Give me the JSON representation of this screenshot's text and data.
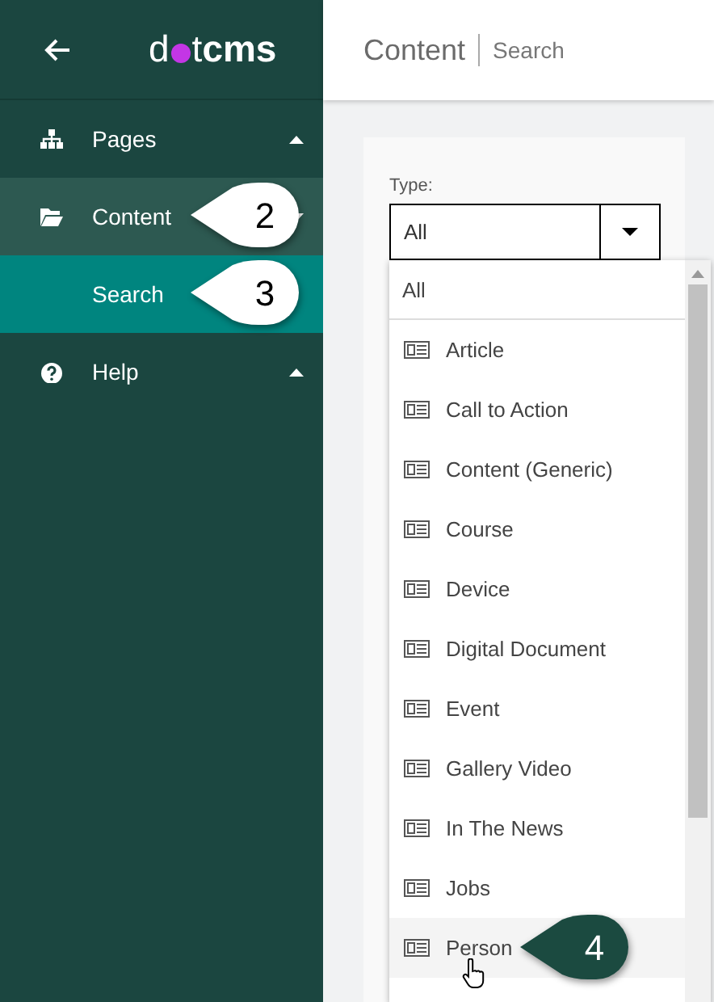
{
  "logo": {
    "before_dot": "d",
    "after_dot": "t",
    "bold": "cms"
  },
  "sidebar": {
    "items": [
      {
        "label": "Pages",
        "selected": false,
        "expanded": false
      },
      {
        "label": "Content",
        "selected": false,
        "expanded": true,
        "children": [
          {
            "label": "Search",
            "selected": true
          }
        ]
      },
      {
        "label": "Help",
        "selected": false,
        "expanded": false
      }
    ]
  },
  "header": {
    "title": "Content",
    "subtitle": "Search"
  },
  "type_field": {
    "label": "Type:",
    "value": "All"
  },
  "dropdown": {
    "items": [
      {
        "label": "All",
        "kind": "plain",
        "hovered": false
      },
      {
        "label": "Article",
        "kind": "type",
        "hovered": false
      },
      {
        "label": "Call to Action",
        "kind": "type",
        "hovered": false
      },
      {
        "label": "Content (Generic)",
        "kind": "type",
        "hovered": false
      },
      {
        "label": "Course",
        "kind": "type",
        "hovered": false
      },
      {
        "label": "Device",
        "kind": "type",
        "hovered": false
      },
      {
        "label": "Digital Document",
        "kind": "type",
        "hovered": false
      },
      {
        "label": "Event",
        "kind": "type",
        "hovered": false
      },
      {
        "label": "Gallery Video",
        "kind": "type",
        "hovered": false
      },
      {
        "label": "In The News",
        "kind": "type",
        "hovered": false
      },
      {
        "label": "Jobs",
        "kind": "type",
        "hovered": false
      },
      {
        "label": "Person",
        "kind": "type",
        "hovered": true
      }
    ]
  },
  "callouts": [
    {
      "number": "2",
      "color": "#ffffff"
    },
    {
      "number": "3",
      "color": "#ffffff"
    },
    {
      "number": "4",
      "color": "#1b4a40"
    }
  ]
}
